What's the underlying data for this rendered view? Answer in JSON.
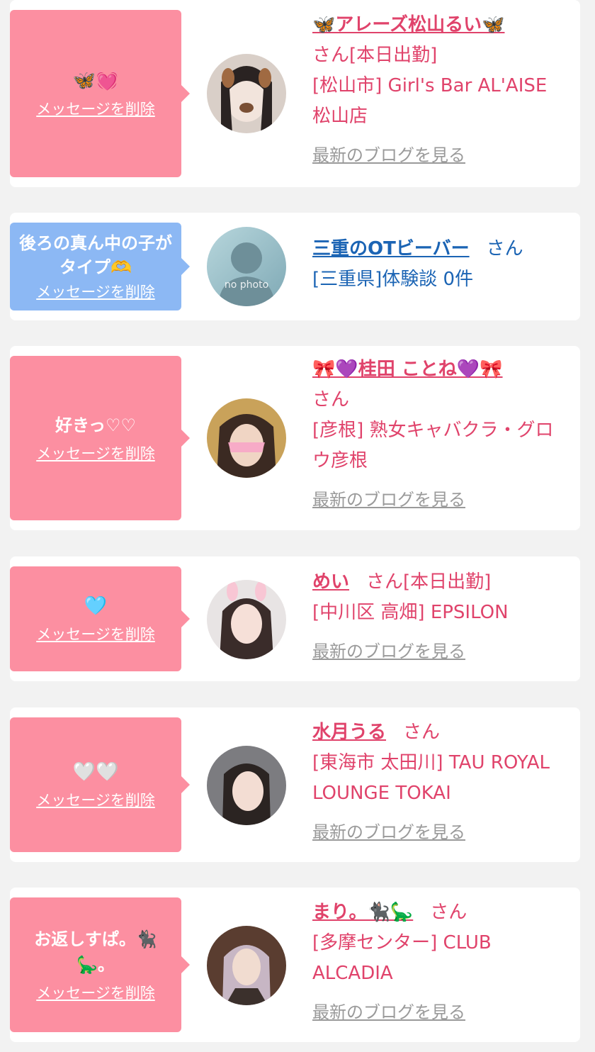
{
  "delete_label": "メッセージを削除",
  "blog_label": "最新のブログを見る",
  "san_label": "さん",
  "colors": {
    "bubble_pink": "#fc8fa1",
    "bubble_blue": "#8cb8f4",
    "text_pink": "#e0436b",
    "text_blue": "#1b64b4"
  },
  "messages": [
    {
      "bubble_text": "🦋💓",
      "name": "🦋アレーズ松山るい🦋",
      "status": "[本日出勤]",
      "shop": "[松山市] Girl's Bar AL'AISE 松山店",
      "has_blog": true
    },
    {
      "bubble_text": "後ろの真ん中の子がタイプ🫶",
      "name": "三重のOTビーバー",
      "status": "",
      "shop": "[三重県]体験談 0件",
      "has_blog": false,
      "avatar_text": "no photo"
    },
    {
      "bubble_text": "好きっ♡♡",
      "name": "🎀💜桂田 ことね💜🎀",
      "status": "",
      "shop": "[彦根] 熟女キャバクラ・グロウ彦根",
      "has_blog": true
    },
    {
      "bubble_text": "🩵",
      "name": "めい",
      "status": "[本日出勤]",
      "shop": "[中川区 高畑] EPSILON",
      "has_blog": true
    },
    {
      "bubble_text": "🤍🤍",
      "name": "水月うる",
      "status": "",
      "shop": "[東海市 太田川] TAU ROYAL LOUNGE TOKAI",
      "has_blog": true
    },
    {
      "bubble_text": "お返しすぱ。🐈‍⬛🦕。",
      "name": "まり。🐈‍⬛🦕",
      "status": "",
      "shop": "[多摩センター] CLUB ALCADIA",
      "has_blog": true
    }
  ]
}
